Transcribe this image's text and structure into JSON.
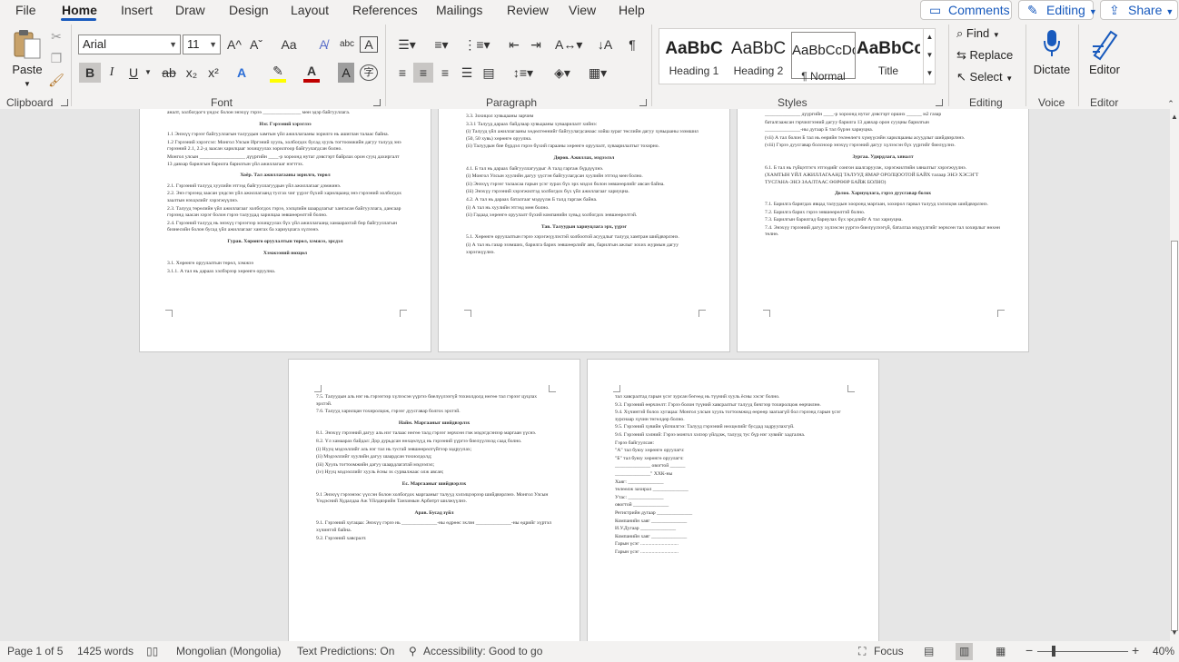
{
  "menu": {
    "file": "File",
    "home": "Home",
    "insert": "Insert",
    "draw": "Draw",
    "design": "Design",
    "layout": "Layout",
    "references": "References",
    "mailings": "Mailings",
    "review": "Review",
    "view": "View",
    "help": "Help"
  },
  "top": {
    "comments": "Comments",
    "editing": "Editing",
    "share": "Share"
  },
  "ribbon": {
    "clipboard": {
      "paste": "Paste",
      "label": "Clipboard"
    },
    "font": {
      "name": "Arial",
      "size": "11",
      "label": "Font",
      "bold": "B",
      "italic": "I",
      "underline": "U",
      "strike": "ab",
      "sub": "x₂",
      "sup": "x²",
      "grow": "A^",
      "shrink": "Aˇ",
      "case": "Aa",
      "color_text": "A",
      "accent": "#c00000",
      "highlight": "#ffff00"
    },
    "paragraph": {
      "label": "Paragraph"
    },
    "styles": {
      "label": "Styles",
      "items": [
        {
          "sample": "AaBbC",
          "name": "Heading 1"
        },
        {
          "sample": "AaBbC",
          "name": "Heading 2"
        },
        {
          "sample": "AaBbCcDc",
          "name": "¶ Normal"
        },
        {
          "sample": "AaBbCcl",
          "name": "Title"
        }
      ]
    },
    "editing": {
      "label": "Editing",
      "find": "Find",
      "replace": "Replace",
      "select": "Select"
    },
    "voice": {
      "label": "Voice",
      "dictate": "Dictate"
    },
    "editor": {
      "label": "Editor",
      "editor": "Editor"
    }
  },
  "pages": {
    "p1": {
      "lines": [
        "аналт, холбогдогч үндэс болон энэхүү гэрээ _______________ мөн эдэр байгууллага.",
        "§Нэг. Гэрээний хэрэглээ",
        "1.1 Энэхүү гэрээг байгууллагын талуудын хамтын үйл ажиллагааны зорилго нь ашиглан талаас байна.",
        "1.2 Гэрээний хэрэгсэл: Монгол Улсын Иргэний хууль, холбогдох бусад хууль тогтоомжийн дагуу талууд энэ гэрээний 2.1, 2.2-д заасан харилцааг зохицуулах зорилгоор байгуулагдсан болно.",
        "Монгол улсын __________________ дүүргийн ____-р хороонд нутаг дэвсгэрт байрлах орон сууц дахиргалт 13 давхар барилгын барилга барилгын үйл ажиллагааг нэгтгэх.",
        "§Хоёр. Тал ажиллагааны зорилго, төрөл",
        "2.1. Гэрээний талууд хуулийн этгээд байгууллагуудын үйл ажиллагааг дэмжинэ.",
        "2.2. Энэ гэрээнд заасан үндсэн үйл ажиллагаанд тусгах чиг үүрэг бүхий харилцаанд энэ гэрээний холбогдох заалтын нэхцэлийг хэрэгжүүлнэ.",
        "2.3. Талууд төрөлийн үйл ажиллагааг холбогдох гэрээ, хэлцлийн шаардлагыг хангасан байгууллага, дансаар гэрээнд заасан хэрэг болон гэрээ талуудад харилцаа зөвшөөрөлтэй болно.",
        "2.4. Гэрээний талууд нь энэхүү гэрээгээр зохицуулах бүх үйл ажиллагаанд хамаарахтай бөр байгууллагын бизнесийн болон бусад үйл ажиллагааг хангах ба хариуцлага хүлээнэ.",
        "§Гурав. Хөрөнгө оруулалтын төрөл, хэмжээ, эрсдэл",
        "§Хэмжээний нөхцөл",
        "3.1. Хөрөнгө оруулалтын төрөл, хэмжээ",
        "3.1.1. А тал нь дараах хэлбэрээр хөрөнгө оруулна."
      ]
    },
    "p2": {
      "lines": [
        "3.3. Зохицол хувьцааны зарчим",
        "3.3.1 Талууд дараах байдлаар хувьцааны хуваарилалт хийнэ:",
        "(i) Талууд үйл ажиллагааны хөдөлгөөнийг байгуулагдсанаас хойш зураг төслийн дагуу хувьцааны эзэмшил (50, 50 хувь) хөрөнгө оруулна.",
        "(ii) Талуудын бие бүрдэл гэрээ бүхий гарааны хөрөнгө оруулалт, хуваарилалтыг тохирно.",
        "§Дөрөв. Ажиллах, мэдээлэл",
        "4.1. Б тал нь дараах байгууллагуудыг А талд гаргаж бүрдүүлнэ.",
        "(i) Монгол Улсын хуулийн дагуу үүсгэн байгуулагдсан хуулийн этгээд мөн болно.",
        "(ii) Энэхүү гэрээг талаасаа гарын үсэг зурах бүх эрх мэдэл болон зөвшөөрлийг авсан байна.",
        "(iii) Энэхүү гэрээний хэрэгжилтэд холбогдох бүх үйл ажиллагааг хариуцна.",
        "4.2. А тал нь дараах баталгааг мэдүүлж Б талд гаргаж байна.",
        "(i) А тал нь хуулийн этгээд мөн болно.",
        "(ii) Гадаад хөрөнгө оруулалт бүхий компанийн хувьд холбогдох зөвшөөрөлтэй.",
        "§Тав. Талуудын хариуцлага эрх, үүрэг",
        "5.1. Хөрөнгө оруулалтын гэрээ хэрэгжүүлэхтэй холбоотой асуудлыг талууд хамтран шийдвэрлэнэ.",
        "(i) А тал нь газар эзэмших, барилга барих зөвшөөрлийг авч, барилгын ажлыг зохих журмын дагуу хэрэгжүүлнэ."
      ]
    },
    "p3": {
      "lines": [
        "______________ дүүргийн ____-р хороонд нутаг дэвсгэрт орших ______ м2 газар",
        "баталгаажсан гэрчилгээний дагуу барилга 13 давхар орон сууцны барилгын",
        "______________-ны дугаар Б тал бүрэн хариуцна.",
        "(vii) А тал болон Б тал нь өөрийн төлөөлөгч хүмүүсийн харилцааны асуудлыг шийдвэрлэнэ.",
        "(viii) Гэрээ дуусгавар болсноор энэхүү гэрээний дагуу хүлээсэн бүх үүргийг биелүүлнэ.",
        "§Зургаа. Удирдлага, хяналт",
        "6.1. Б тал нь гүйцэтгэгч этгээдийг сонгон шалгаруулж, хэрэгжилтийн хяналтыг хэрэгжүүлнэ.",
        "(ХАМТЫН ҮЙЛ АЖИЛЛАГААНД ТАЛУУД ЯМАР ОРОЛЦООТОЙ БАЙХ талаар ЭНЭ ХЭСЭГТ ТУСГАНА-ЭНЭ ЗААЛТААС ӨӨРӨӨР БАЙЖ БОЛНО)",
        "§Долоо. Хариуцлага, гэрээ дуусгавар болох",
        "7.1. Барилга баригдах явцад талуудын хооронд маргаан, хохирол гарвал талууд хэлэлцэж шийдвэрлэнэ.",
        "7.2. Барилга барих гэрээ зөвшөөрөлтэй болно.",
        "7.3. Барилгын барилгад бариулах бүх эрсдлийг А тал хариуцна.",
        "7.4. Энэхүү гэрээний дагуу хүлээсэн үүргээ биелүүлээгүй, баталгаа мэдүүлгийг зөрчсөн тал хохирлыг нөхөн төлнө."
      ]
    },
    "p4": {
      "lines": [
        "7.5. Талуудын аль нэг нь гэрээгээр хүлээсэн үүргээ биелүүлээгүй тохиолдолд нөгөө тал гэрээг цуцлах эрхтэй.",
        "7.6. Талууд харилцан тохиролцож, гэрээг дуусгавар болгох эрхтэй.",
        "§Найм. Маргааныг шийдвэрлэх",
        "8.1. Энэхүү гэрээний дагуу аль нэг талаас нөгөө талд гэрээг зөрчсөн гэж мэдэгдсэнээр маргаан үүснэ.",
        "8.2. Үл хамаарах байдал: Дор дурьдсан нөхцөлүүд нь гэрээний үүргээ биелүүлэхэд саад болно.",
        "(i) Нууц мэдээллийг аль нэг тал нь тусгай зөвшөөрөлгүйгээр задруулах;",
        "(ii) Мэдээллийг хуулийн дагуу шаардсан тохиолдолд;",
        "(iii) Хууль тогтоомжийн дагуу шаардлагатай мэдээлэл;",
        "(iv) Нууц мэдээллийг хууль ёсны эх сурвалжаас олж авсан;",
        "§Ес. Маргааныг шийдвэрлэх",
        "9.1 Энэхүү гэрээнээс үүссэн болон холбогдох маргааныг талууд хэлэлцээрээр шийдвэрлэнэ. Монгол Улсын Үндэсний Худалдаа Аж Үйлдвэрийн Танхимын Арбитрт шилжүүлнэ.",
        "§Арав. Бусад зүйл",
        "9.1. Гэрээний хугацаа: Энэхүү гэрээ нь ______________-ны өдрөөс эхлэн ______________-ны өдрийг хүртэл хүчинтэй байна.",
        "9.2. Гэрээний хавсралт."
      ]
    },
    "p5": {
      "lines": [
        "тал хавсралтад гарын үсэг зурсан бөгөөд нь түүний хууль ёсны хэсэг болно.",
        "9.3. Гэрээний өөрчлөлт: Гэрээ болон түүний хавсралтыг талууд бичгээр тохиролцож өөрчилнө.",
        "9.4. Хүчинтэй болох хугацаа: Монгол улсын хууль тогтоомжид өөрөөр заагаагүй бол гэрээнд гарын үсэг зурснаар хүчин төгөлдөр болно.",
        "9.5. Гэрээний хувийн үйлчилгээ: Талууд гэрээний нөхцөлийг бусдад задруулахгүй.",
        "9.6. Гэрээний хэлний: Гэрээ монгол хэлээр үйлдэж, талууд тус бүр нэг хувийг хадгална.",
        "Гэрээ байгуулсан:",
        "\"А\" тал буюу хөрөнгө оруулагч:",
        "\"Б\" тал буюу хөрөнгө оруулагч:",
        "______________ овогтой ______",
        "______________\" ХХК-ны",
        "Хаяг: ______________",
        "төлөөлж захирал ______________",
        "Утас: ______________",
        "овогтой ______________",
        "Регистрийн дугаар ______________",
        "Компанийн хаяг ______________",
        "И.У.Дугаар ______________",
        "Компанийн хаяг ______________",
        "Гарын үсэг ..............................",
        "Гарын үсэг .............................."
      ]
    }
  },
  "status": {
    "page": "Page 1 of 5",
    "words": "1425 words",
    "language": "Mongolian (Mongolia)",
    "predictions": "Text Predictions: On",
    "accessibility": "Accessibility: Good to go",
    "focus": "Focus",
    "zoom": "40%"
  }
}
